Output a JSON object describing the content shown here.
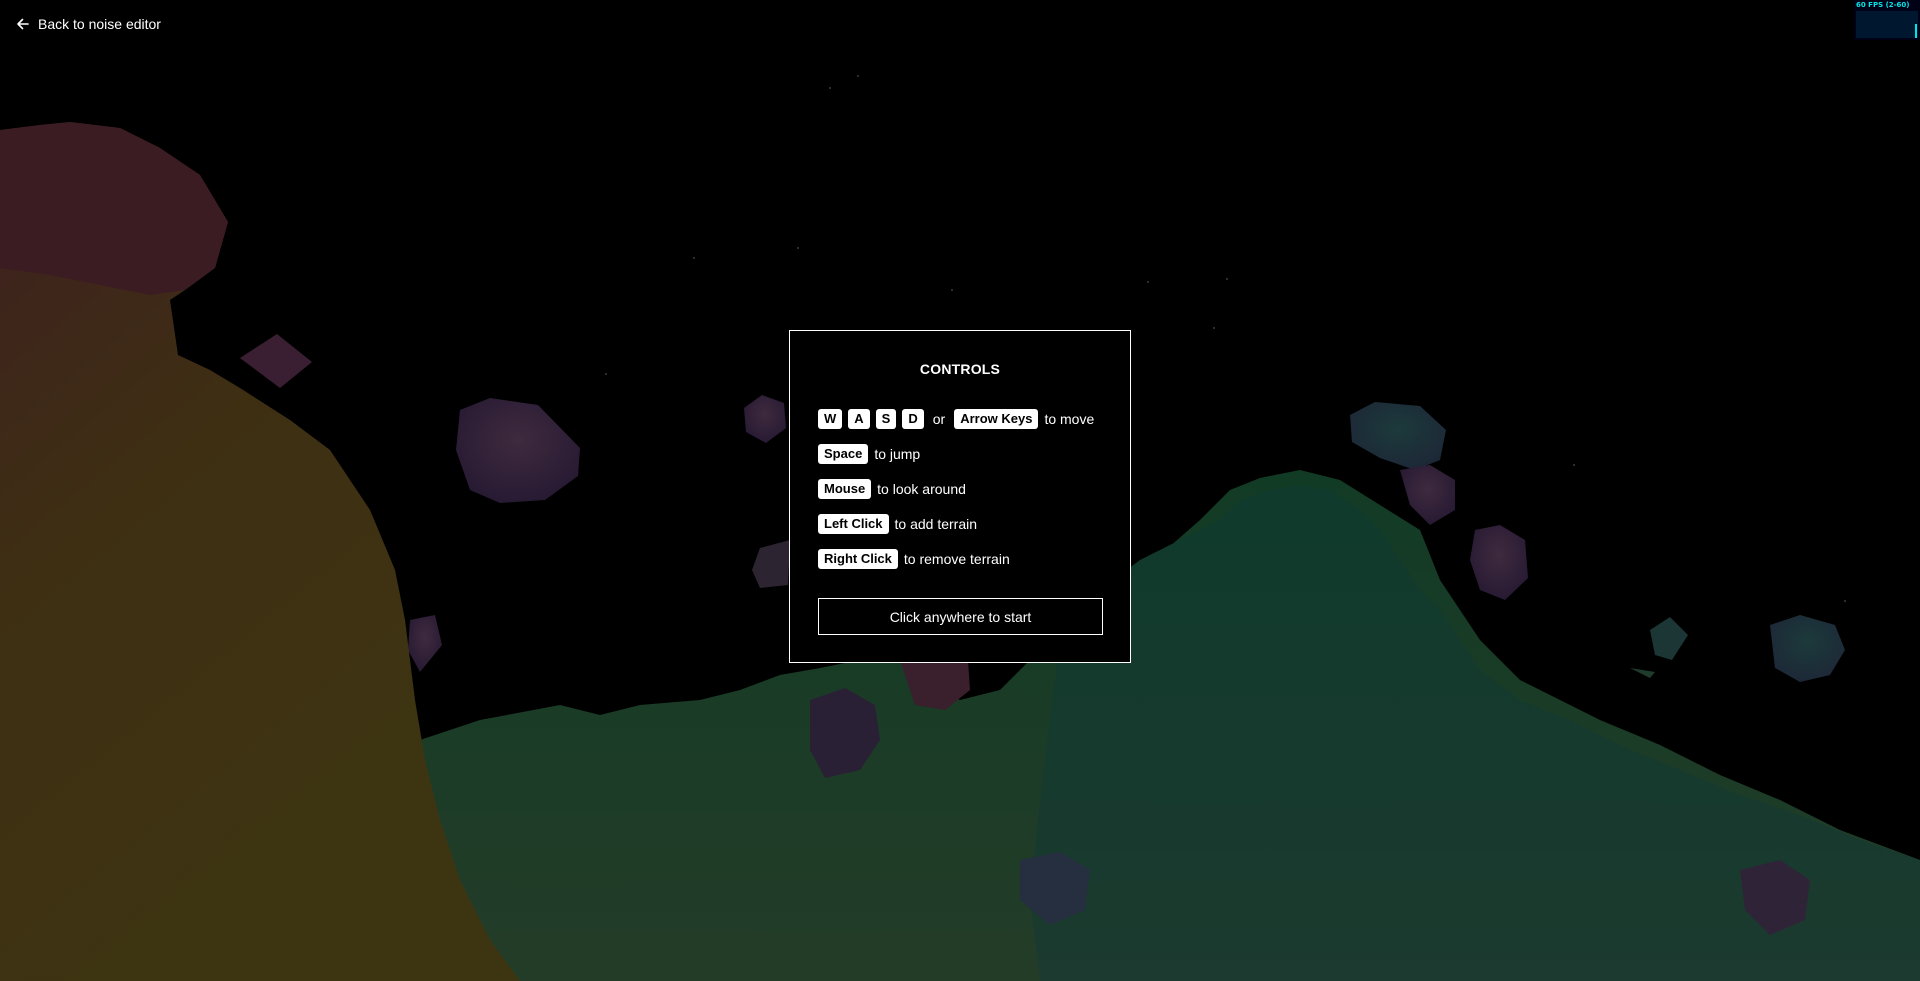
{
  "nav": {
    "back_label": "Back to noise editor",
    "back_icon": "arrow-left-icon"
  },
  "fps": {
    "text": "60 FPS (2-60)",
    "value": 60,
    "min": 2,
    "max": 60,
    "color": "#00ffff"
  },
  "controls": {
    "title": "CONTROLS",
    "move": {
      "keys": [
        "W",
        "A",
        "S",
        "D"
      ],
      "or": "or",
      "alt_key": "Arrow Keys",
      "action": "to move"
    },
    "jump": {
      "key": "Space",
      "action": "to jump"
    },
    "look": {
      "key": "Mouse",
      "action": "to look around"
    },
    "add": {
      "key": "Left Click",
      "action": "to add terrain"
    },
    "remove": {
      "key": "Right Click",
      "action": "to remove terrain"
    },
    "start_label": "Click anywhere to start"
  }
}
